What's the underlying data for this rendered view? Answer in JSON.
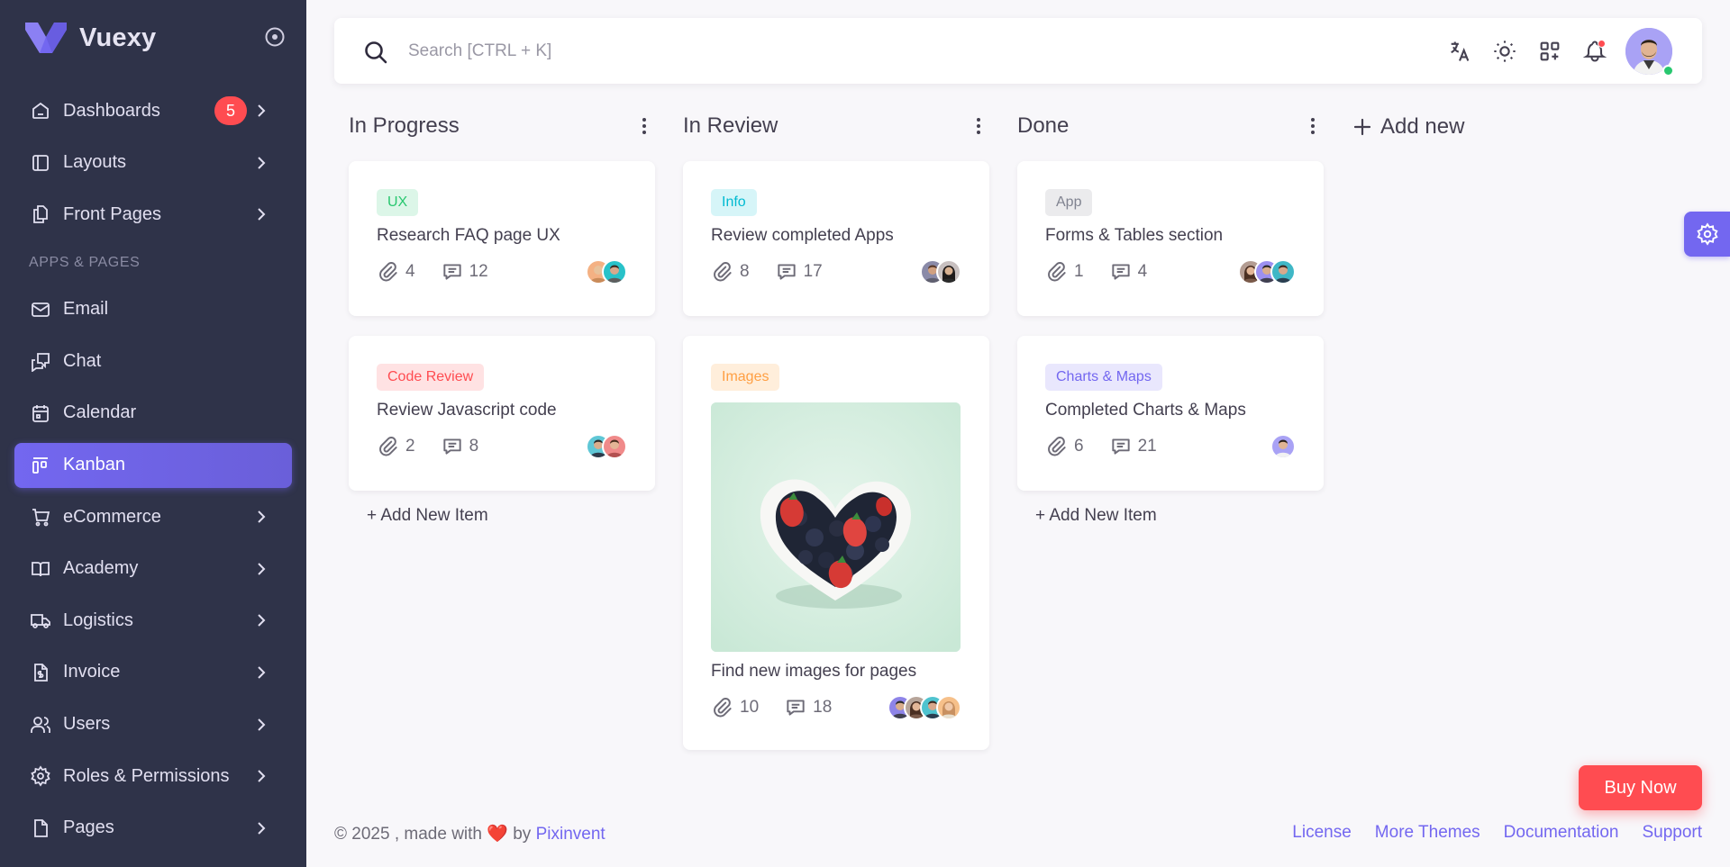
{
  "brand": {
    "name": "Vuexy"
  },
  "sidebar": {
    "items": [
      {
        "label": "Dashboards",
        "badge": "5"
      },
      {
        "label": "Layouts"
      },
      {
        "label": "Front Pages"
      },
      {
        "section": "APPS & PAGES"
      },
      {
        "label": "Email"
      },
      {
        "label": "Chat"
      },
      {
        "label": "Calendar"
      },
      {
        "label": "Kanban",
        "active": true
      },
      {
        "label": "eCommerce"
      },
      {
        "label": "Academy"
      },
      {
        "label": "Logistics"
      },
      {
        "label": "Invoice"
      },
      {
        "label": "Users"
      },
      {
        "label": "Roles & Permissions"
      },
      {
        "label": "Pages"
      }
    ]
  },
  "navbar": {
    "search_placeholder": "Search [CTRL + K]",
    "icons": [
      "translate-icon",
      "sun-icon",
      "shortcuts-icon",
      "bell-icon"
    ]
  },
  "kanban": {
    "columns": [
      {
        "title": "In Progress",
        "cards": [
          {
            "tag": "UX",
            "title": "Research FAQ page UX",
            "attachments": "4",
            "comments": "12"
          },
          {
            "tag": "Code Review",
            "title": "Review Javascript code",
            "attachments": "2",
            "comments": "8"
          }
        ],
        "add_item": "+ Add New Item"
      },
      {
        "title": "In Review",
        "cards": [
          {
            "tag": "Info",
            "title": "Review completed Apps",
            "attachments": "8",
            "comments": "17"
          },
          {
            "tag": "Images",
            "title": "Find new images for pages",
            "attachments": "10",
            "comments": "18"
          }
        ]
      },
      {
        "title": "Done",
        "cards": [
          {
            "tag": "App",
            "title": "Forms & Tables section",
            "attachments": "1",
            "comments": "4"
          },
          {
            "tag": "Charts & Maps",
            "title": "Completed Charts & Maps",
            "attachments": "6",
            "comments": "21"
          }
        ],
        "add_item": "+ Add New Item"
      }
    ],
    "add_new": "Add new"
  },
  "buy_now": "Buy Now",
  "footer": {
    "copyright_prefix": "© 2025 , made with",
    "by": "by",
    "company": "Pixinvent",
    "links": [
      "License",
      "More Themes",
      "Documentation",
      "Support"
    ]
  },
  "colors": {
    "primary": "#7367f0",
    "sidebar_bg": "#2f3349",
    "danger": "#ff4c51",
    "success": "#28c76f",
    "info": "#00bad1",
    "warning": "#ff9f43"
  }
}
